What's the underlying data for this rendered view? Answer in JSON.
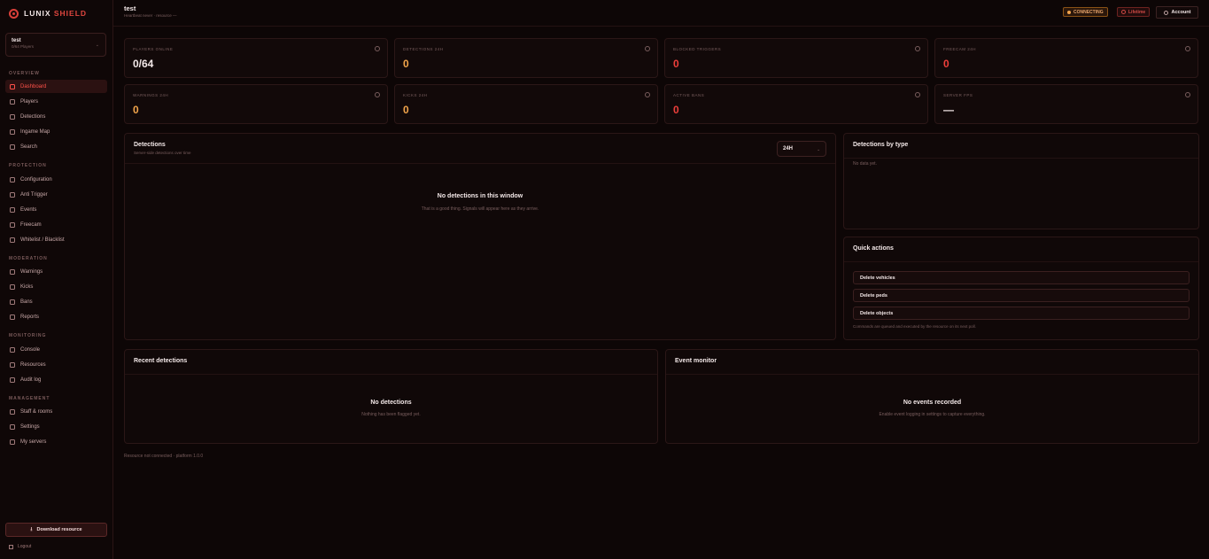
{
  "brand": {
    "name": "LUNIX",
    "accent": "SHIELD"
  },
  "server": {
    "name": "test",
    "sub": "0/64 Players"
  },
  "sidebar": {
    "sections": [
      {
        "label": "OVERVIEW",
        "items": [
          {
            "label": "Dashboard",
            "active": true
          },
          {
            "label": "Players"
          },
          {
            "label": "Detections"
          },
          {
            "label": "Ingame Map"
          },
          {
            "label": "Search"
          }
        ]
      },
      {
        "label": "PROTECTION",
        "items": [
          {
            "label": "Configuration"
          },
          {
            "label": "Anti Trigger"
          },
          {
            "label": "Events"
          },
          {
            "label": "Freecam"
          },
          {
            "label": "Whitelist / Blacklist"
          }
        ]
      },
      {
        "label": "MODERATION",
        "items": [
          {
            "label": "Warnings"
          },
          {
            "label": "Kicks"
          },
          {
            "label": "Bans"
          },
          {
            "label": "Reports"
          }
        ]
      },
      {
        "label": "MONITORING",
        "items": [
          {
            "label": "Console"
          },
          {
            "label": "Resources"
          },
          {
            "label": "Audit log"
          }
        ]
      },
      {
        "label": "MANAGEMENT",
        "items": [
          {
            "label": "Staff & rooms"
          },
          {
            "label": "Settings"
          },
          {
            "label": "My servers"
          }
        ]
      }
    ],
    "download_label": "Download resource",
    "logout_label": "Logout"
  },
  "topbar": {
    "title": "test",
    "subtitle": "Heartbeat never · resource —",
    "status": "CONNECTING",
    "license": "Lifetime",
    "account": "Account"
  },
  "stats": [
    {
      "label": "PLAYERS ONLINE",
      "value": "0/64",
      "tone": "white"
    },
    {
      "label": "DETECTIONS 24H",
      "value": "0",
      "tone": "amber"
    },
    {
      "label": "BLOCKED TRIGGERS",
      "value": "0",
      "tone": "red"
    },
    {
      "label": "FREECAM 24H",
      "value": "0",
      "tone": "red"
    },
    {
      "label": "WARNINGS 24H",
      "value": "0",
      "tone": "amber"
    },
    {
      "label": "KICKS 24H",
      "value": "0",
      "tone": "amber"
    },
    {
      "label": "ACTIVE BANS",
      "value": "0",
      "tone": "red"
    },
    {
      "label": "SERVER FPS",
      "value": "—",
      "tone": "white"
    }
  ],
  "detections_panel": {
    "title": "Detections",
    "subtitle": "Server-side detections over time",
    "range": "24H",
    "empty_title": "No detections in this window",
    "empty_sub": "That is a good thing. Signals will appear here as they arrive."
  },
  "by_type_panel": {
    "title": "Detections by type",
    "empty": "No data yet."
  },
  "quick_actions": {
    "title": "Quick actions",
    "buttons": [
      "Delete vehicles",
      "Delete peds",
      "Delete objects"
    ],
    "note": "Commands are queued and executed by the resource on its next poll."
  },
  "recent_panel": {
    "title": "Recent detections",
    "empty_title": "No detections",
    "empty_sub": "Nothing has been flagged yet."
  },
  "event_panel": {
    "title": "Event monitor",
    "empty_title": "No events recorded",
    "empty_sub": "Enable event logging in settings to capture everything."
  },
  "footer": "Resource not connected · platform 1.0.0"
}
